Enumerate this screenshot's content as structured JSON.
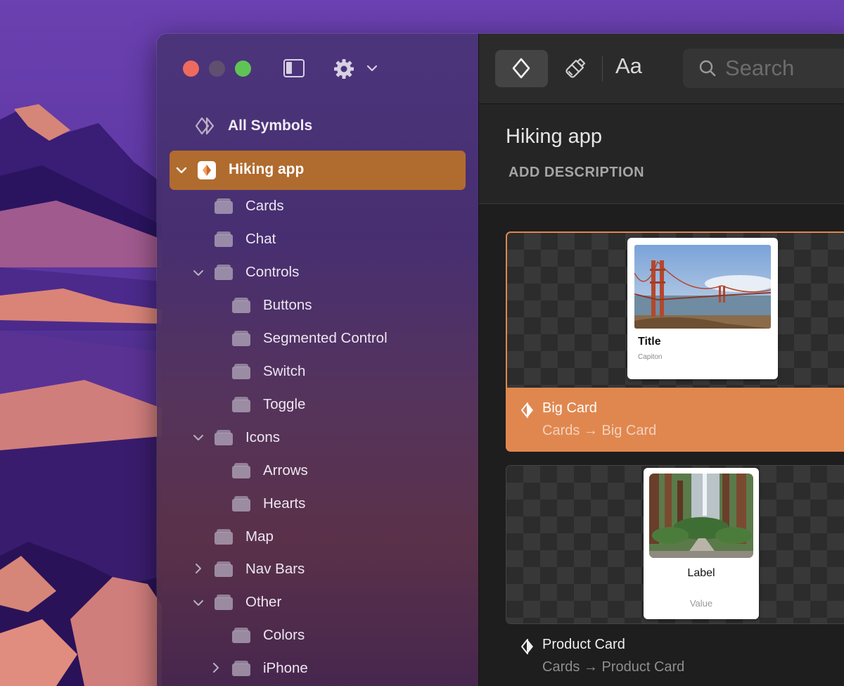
{
  "sidebar": {
    "all_symbols_label": "All Symbols",
    "selected_project": "Hiking app",
    "items": [
      {
        "label": "Cards"
      },
      {
        "label": "Chat"
      },
      {
        "label": "Controls"
      },
      {
        "label": "Buttons"
      },
      {
        "label": "Segmented Control"
      },
      {
        "label": "Switch"
      },
      {
        "label": "Toggle"
      },
      {
        "label": "Icons"
      },
      {
        "label": "Arrows"
      },
      {
        "label": "Hearts"
      },
      {
        "label": "Map"
      },
      {
        "label": "Nav Bars"
      },
      {
        "label": "Other"
      },
      {
        "label": "Colors"
      },
      {
        "label": "iPhone"
      }
    ]
  },
  "toolbar": {
    "text_tool_label": "Aa",
    "search_placeholder": "Search"
  },
  "header": {
    "title": "Hiking app",
    "add_description": "ADD DESCRIPTION"
  },
  "symbols": [
    {
      "name": "Big Card",
      "path": "Cards → Big Card",
      "preview_title": "Title",
      "preview_caption": "Capiton"
    },
    {
      "name": "Product Card",
      "path": "Cards → Product Card",
      "preview_label": "Label",
      "preview_value": "Value"
    }
  ],
  "colors": {
    "accent_selected_row": "#b06b2e",
    "accent_selected_card": "#e0874f",
    "traffic_close": "#ee6a5f",
    "traffic_max": "#5fc454"
  }
}
